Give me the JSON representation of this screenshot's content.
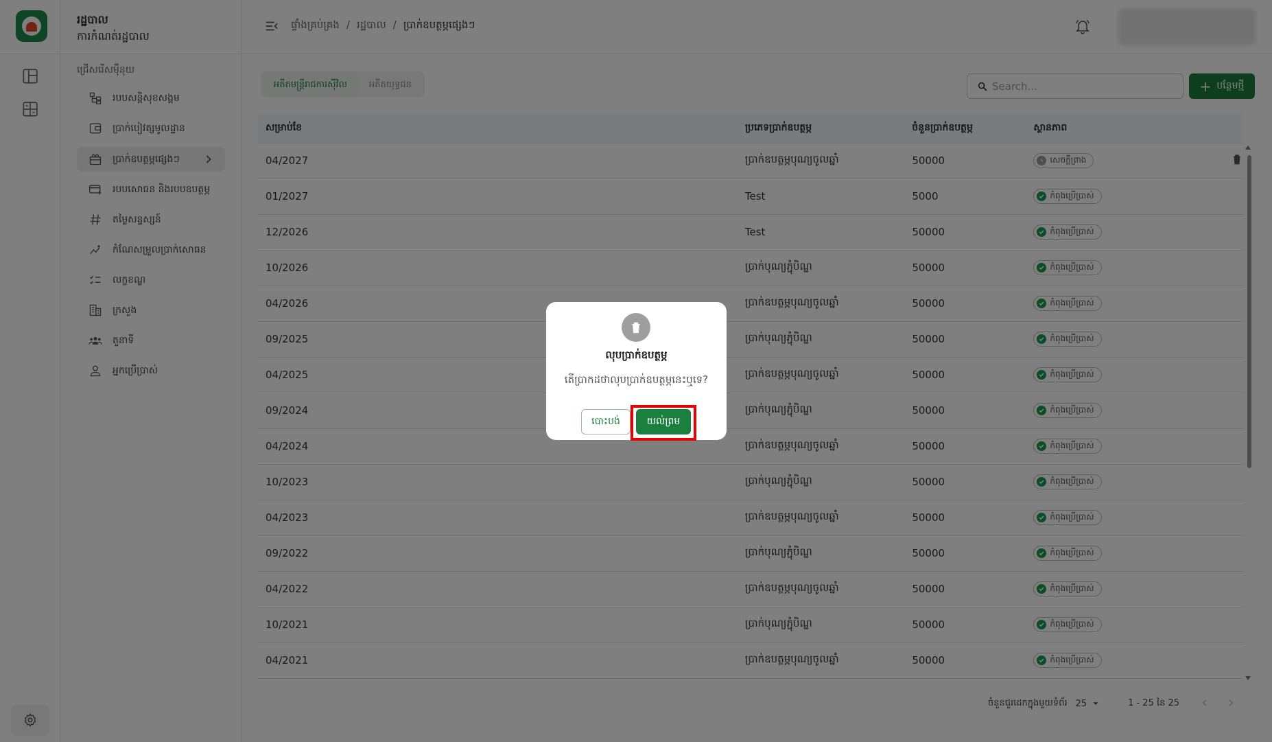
{
  "app": {
    "title": "រដ្ឋបាល",
    "subtitle": "ការកំណត់រដ្ឋបាល"
  },
  "sidebar": {
    "section_label": "ជ្រើសរើសម៉ឺនុយ",
    "items": [
      {
        "label": "របបសន្តិសុខសង្គម",
        "icon": "hierarchy-icon"
      },
      {
        "label": "ប្រាក់បៀវត្សមូលដ្ឋាន",
        "icon": "wallet-icon"
      },
      {
        "label": "ប្រាក់ឧបត្ថម្ភផ្សេងៗ",
        "icon": "gift-icon"
      },
      {
        "label": "របបសោធន និងរបបឧបត្ថម្ភ",
        "icon": "card-add-icon"
      },
      {
        "label": "តម្លៃសន្ទស្សន៍",
        "icon": "hash-icon"
      },
      {
        "label": "កំណែសម្រួលប្រាក់សោធន",
        "icon": "chart-sparkle-icon"
      },
      {
        "label": "លក្ខខណ្ឌ",
        "icon": "checklist-icon"
      },
      {
        "label": "ក្រសួង",
        "icon": "building-icon"
      },
      {
        "label": "តួនាទី",
        "icon": "group-icon"
      },
      {
        "label": "អ្នកប្រើប្រាស់",
        "icon": "person-icon"
      }
    ],
    "active_index": 2
  },
  "breadcrumb": [
    "ផ្ទាំងគ្រប់គ្រង",
    "រដ្ឋបាល",
    "ប្រាក់ឧបត្ថម្ភផ្សេងៗ"
  ],
  "tabs": [
    {
      "label": "អតីតមន្ត្រីរាជការស៊ីវិល"
    },
    {
      "label": "អតីតយុទ្ធជន"
    }
  ],
  "search": {
    "placeholder": "Search..."
  },
  "add_button": {
    "label": "បន្ថែមថ្មី"
  },
  "table": {
    "headers": [
      "សម្រាប់ខែ",
      "ប្រភេទប្រាក់ឧបត្ថម្ភ",
      "ចំនួនប្រាក់ឧបត្ថម្ភ",
      "ស្ថានភាព"
    ],
    "rows": [
      [
        "04/2027",
        "ប្រាក់ឧបត្ថម្ភបុណ្យចូលឆ្នាំ",
        "50000",
        "សេចក្តីព្រាង"
      ],
      [
        "01/2027",
        "Test",
        "5000",
        "កំពុងប្រើប្រាស់"
      ],
      [
        "12/2026",
        "Test",
        "50000",
        "កំពុងប្រើប្រាស់"
      ],
      [
        "10/2026",
        "ប្រាក់បុណ្យភ្ជុំបិណ្ឌ",
        "50000",
        "កំពុងប្រើប្រាស់"
      ],
      [
        "04/2026",
        "ប្រាក់ឧបត្ថម្ភបុណ្យចូលឆ្នាំ",
        "50000",
        "កំពុងប្រើប្រាស់"
      ],
      [
        "09/2025",
        "ប្រាក់បុណ្យភ្ជុំបិណ្ឌ",
        "50000",
        "កំពុងប្រើប្រាស់"
      ],
      [
        "04/2025",
        "ប្រាក់ឧបត្ថម្ភបុណ្យចូលឆ្នាំ",
        "50000",
        "កំពុងប្រើប្រាស់"
      ],
      [
        "09/2024",
        "ប្រាក់បុណ្យភ្ជុំបិណ្ឌ",
        "50000",
        "កំពុងប្រើប្រាស់"
      ],
      [
        "04/2024",
        "ប្រាក់ឧបត្ថម្ភបុណ្យចូលឆ្នាំ",
        "50000",
        "កំពុងប្រើប្រាស់"
      ],
      [
        "10/2023",
        "ប្រាក់បុណ្យភ្ជុំបិណ្ឌ",
        "50000",
        "កំពុងប្រើប្រាស់"
      ],
      [
        "04/2023",
        "ប្រាក់ឧបត្ថម្ភបុណ្យចូលឆ្នាំ",
        "50000",
        "កំពុងប្រើប្រាស់"
      ],
      [
        "09/2022",
        "ប្រាក់បុណ្យភ្ជុំបិណ្ឌ",
        "50000",
        "កំពុងប្រើប្រាស់"
      ],
      [
        "04/2022",
        "ប្រាក់ឧបត្ថម្ភបុណ្យចូលឆ្នាំ",
        "50000",
        "កំពុងប្រើប្រាស់"
      ],
      [
        "10/2021",
        "ប្រាក់បុណ្យភ្ជុំបិណ្ឌ",
        "50000",
        "កំពុងប្រើប្រាស់"
      ],
      [
        "04/2021",
        "ប្រាក់ឧបត្ថម្ភបុណ្យចូលឆ្នាំ",
        "50000",
        "កំពុងប្រើប្រាស់"
      ]
    ]
  },
  "pagination": {
    "rows_per_page_label": "ចំនួនជួរដេកក្នុងមួយទំព័រ",
    "rows_per_page": "25",
    "range": "1 - 25 នៃ 25"
  },
  "dialog": {
    "title": "លុបប្រាក់ឧបត្ថម្ភ",
    "message": "តើប្រាកដថាលុបប្រាក់ឧបត្ថម្ភនេះឬទេ?",
    "cancel_label": "បោះបង់",
    "confirm_label": "យល់ព្រម"
  },
  "colors": {
    "primary": "#1b7f3e",
    "active_status": "#1b9a4a",
    "draft_status": "#9a9a9a",
    "highlight": "#e60000"
  }
}
